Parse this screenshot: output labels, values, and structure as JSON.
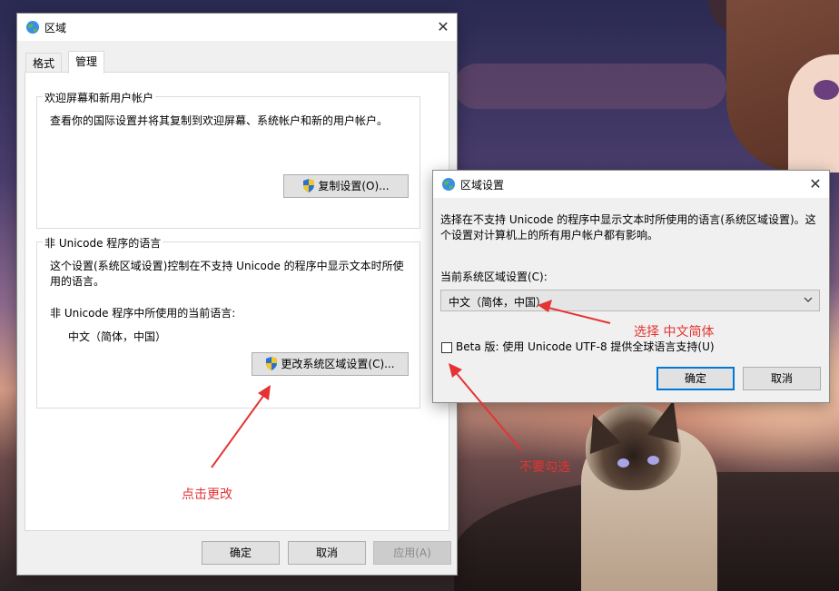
{
  "region_window": {
    "title": "区域",
    "tabs": [
      {
        "label": "格式"
      },
      {
        "label": "管理"
      }
    ],
    "welcome_group": {
      "title": "欢迎屏幕和新用户帐户",
      "description": "查看你的国际设置并将其复制到欢迎屏幕、系统帐户和新的用户帐户。",
      "copy_button": "复制设置(O)..."
    },
    "non_unicode_group": {
      "title": "非 Unicode 程序的语言",
      "description_line1": "这个设置(系统区域设置)控制在不支持 Unicode 的程序中显示文本时所使",
      "description_line2": "用的语言。",
      "current_label": "非 Unicode 程序中所使用的当前语言:",
      "current_value": "中文（简体，中国）",
      "change_button": "更改系统区域设置(C)..."
    },
    "ok_button": "确定",
    "cancel_button": "取消",
    "apply_button": "应用(A)"
  },
  "region_settings_dialog": {
    "title": "区域设置",
    "description_line1": "选择在不支持 Unicode 的程序中显示文本时所使用的语言(系统区域设置)。这",
    "description_line2": "个设置对计算机上的所有用户帐户都有影响。",
    "current_locale_label": "当前系统区域设置(C):",
    "current_locale_value": "中文（简体，中国）",
    "beta_checkbox_label": "Beta 版: 使用 Unicode UTF-8 提供全球语言支持(U)",
    "beta_checked": false,
    "ok_button": "确定",
    "cancel_button": "取消"
  },
  "annotations": {
    "select_chinese": "选择 中文简体",
    "click_change": "点击更改",
    "do_not_check": "不要勾选",
    "color": "#e53333"
  },
  "icons": {
    "window_icon": "globe-icon",
    "button_icon": "uac-shield-icon"
  }
}
